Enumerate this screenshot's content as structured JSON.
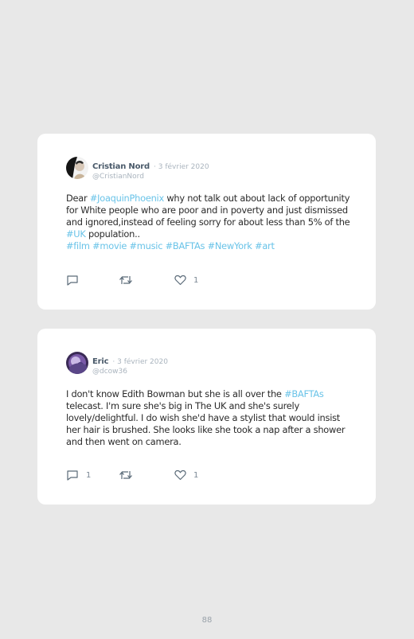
{
  "tweets": [
    {
      "author": "Cristian Nord",
      "date": "· 3 février 2020",
      "handle": "@CristianNord",
      "text_a": "Dear ",
      "tag_1": "#JoaquinPhoenix",
      "text_b": " why not talk out about lack of opportunity for White people who are poor and in poverty and just dismissed and ignored,instead of feeling sorry for about less than 5% of the ",
      "tag_2": "#UK",
      "text_c": " population..",
      "hashtags": [
        "#film",
        "#movie",
        "#music",
        "#BAFTAs",
        "#NewYork",
        "#art"
      ],
      "reply_count": "",
      "like_count": "1"
    },
    {
      "author": "Eric",
      "date": "· 3 février 2020",
      "handle": "@dcow36",
      "text_a": "I don't know Edith Bowman but she is all over the ",
      "tag_1": "#BAFTAs",
      "text_b": " telecast. I'm sure she's big in The UK and she's surely lovely/delightful. I do wish she'd have a stylist that would insist her hair is brushed. She looks like she took a nap after a shower and then went on camera.",
      "reply_count": "1",
      "like_count": "1"
    }
  ],
  "icons": {
    "reply": "reply-icon",
    "retweet": "retweet-icon",
    "like": "heart-icon"
  },
  "colors": {
    "hashtag": "#69c3e8",
    "background": "#e8e8e8",
    "card": "#ffffff"
  },
  "page_number": "88"
}
